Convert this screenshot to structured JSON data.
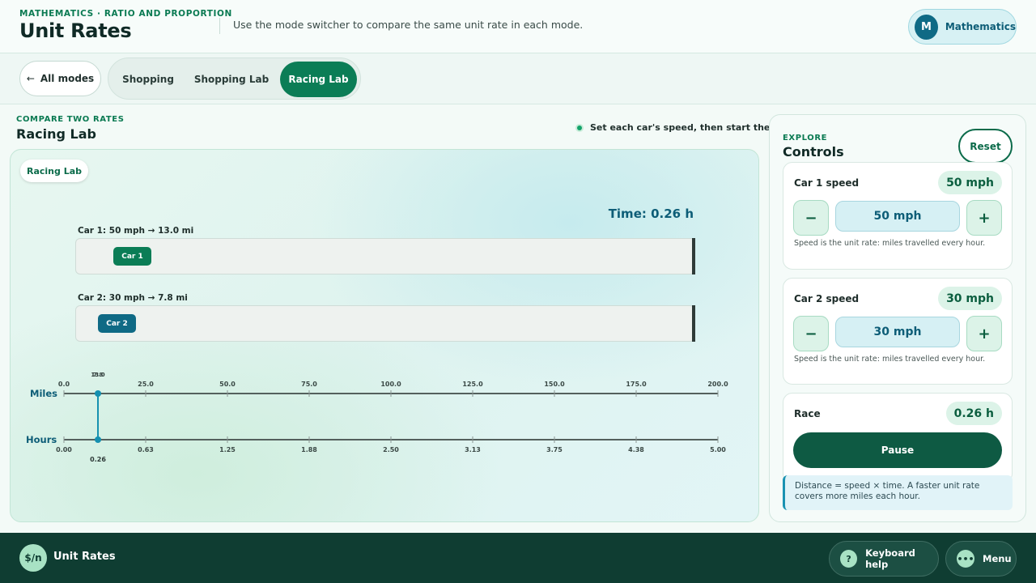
{
  "header": {
    "eyebrow": "MATHEMATICS · RATIO AND PROPORTION",
    "title": "Unit Rates",
    "subtitle": "Use the mode switcher to compare the same unit rate in each mode.",
    "subject_initial": "M",
    "subject_label": "Mathematics"
  },
  "modebar": {
    "all_modes_label": "All modes",
    "tabs": [
      {
        "label": "Shopping",
        "active": false
      },
      {
        "label": "Shopping Lab",
        "active": false
      },
      {
        "label": "Racing Lab",
        "active": true
      }
    ]
  },
  "section": {
    "eyebrow": "COMPARE TWO RATES",
    "title": "Racing Lab",
    "hint": "Set each car's speed, then start the race."
  },
  "stage": {
    "pill": "Racing Lab",
    "timer": "Time: 0.26 h",
    "lanes": [
      {
        "label": "Car 1: 50 mph → 13.0 mi",
        "car": "Car 1",
        "color": "#0b7d56"
      },
      {
        "label": "Car 2: 30 mph → 7.8 mi",
        "car": "Car 2",
        "color": "#0f6a85"
      }
    ],
    "numberline": {
      "miles_label": "Miles",
      "hours_label": "Hours",
      "miles_ticks": [
        "0.0",
        "25.0",
        "50.0",
        "75.0",
        "100.0",
        "125.0",
        "150.0",
        "175.0",
        "200.0"
      ],
      "hours_ticks": [
        "0.00",
        "0.63",
        "1.25",
        "1.88",
        "2.50",
        "3.13",
        "3.75",
        "4.38",
        "5.00"
      ],
      "miles_max": 200,
      "hours_max": 5,
      "marker_miles_labels": [
        "13.0",
        "7.8"
      ],
      "marker_hours_value": 0.26,
      "marker_hours_label": "0.26"
    }
  },
  "controls": {
    "eyebrow": "EXPLORE",
    "title": "Controls",
    "reset": "Reset",
    "car1": {
      "label": "Car 1 speed",
      "badge": "50 mph",
      "value": "50 mph",
      "minus": "−",
      "plus": "+",
      "help": "Speed is the unit rate: miles travelled every hour."
    },
    "car2": {
      "label": "Car 2 speed",
      "badge": "30 mph",
      "value": "30 mph",
      "minus": "−",
      "plus": "+",
      "help": "Speed is the unit rate: miles travelled every hour."
    },
    "race": {
      "label": "Race",
      "badge": "0.26 h",
      "button": "Pause"
    },
    "note": "Distance = speed × time. A faster unit rate covers more miles each hour."
  },
  "footer": {
    "logo": "$/n",
    "app_name": "Unit Rates",
    "keyboard_icon": "?",
    "keyboard_label": "Keyboard help",
    "menu_icon": "•••",
    "menu_label": "Menu"
  }
}
